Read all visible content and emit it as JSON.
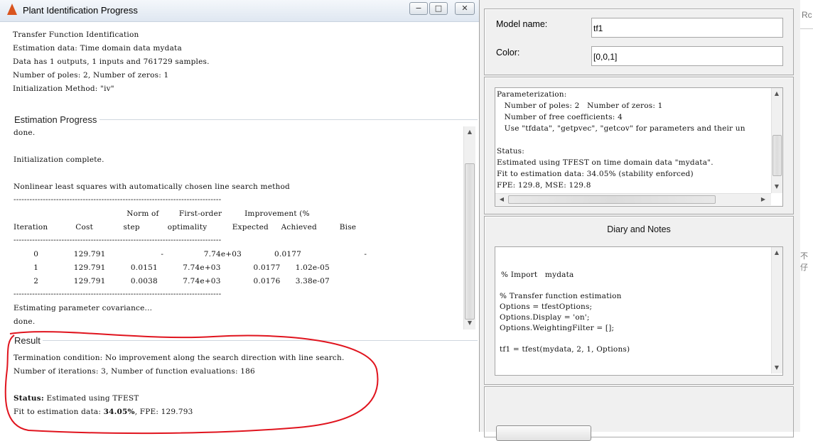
{
  "window": {
    "title": "Plant Identification Progress",
    "minimize": "−",
    "maximize": "□",
    "close": "✕"
  },
  "header_lines": [
    "Transfer Function Identification",
    "Estimation data: Time domain data mydata",
    "Data has 1 outputs, 1 inputs and 761729 samples.",
    "Number of poles: 2, Number of zeros: 1",
    "Initialization Method: \"iv\""
  ],
  "progress": {
    "title": "Estimation Progress",
    "lines": [
      "done.",
      "",
      "Initialization complete.",
      "",
      "Nonlinear least squares with automatically chosen line search method",
      "------------------------------------------------------------------------------",
      "                                             Norm of        First-order         Improvement (%",
      "Iteration           Cost            step           optimality          Expected     Achieved         Bise",
      "------------------------------------------------------------------------------",
      "",
      "        0              129.791                      -                7.74e+03             0.0177                         -",
      "        1              129.791          0.0151          7.74e+03             0.0177      1.02e-05",
      "        2              129.791          0.0038          7.74e+03             0.0176      3.38e-07",
      "------------------------------------------------------------------------------",
      "",
      "Estimating parameter covariance...",
      "done."
    ]
  },
  "result": {
    "title": "Result",
    "termination": "Termination condition: No improvement along the search direction with line search.",
    "iterations": "Number of iterations: 3, Number of function evaluations: 186",
    "status_label": "Status:",
    "status_value": " Estimated using TFEST",
    "fit_prefix": "Fit to estimation data: ",
    "fit_value": "34.05%",
    "fit_suffix": ", FPE: 129.793"
  },
  "model_panel": {
    "model_name_label": "Model name:",
    "model_name_value": "tf1",
    "color_label": "Color:",
    "color_value": "[0,0,1]"
  },
  "info": {
    "lines": [
      "Parameterization:",
      "   Number of poles: 2   Number of zeros: 1",
      "   Number of free coefficients: 4",
      "   Use \"tfdata\", \"getpvec\", \"getcov\" for parameters and their un",
      "",
      "Status:",
      "Estimated using TFEST on time domain data \"mydata\".",
      "Fit to estimation data: 34.05% (stability enforced)",
      "FPE: 129.8, MSE: 129.8"
    ]
  },
  "diary": {
    "title": "Diary and Notes",
    "lines": [
      "",
      "",
      "% Import   mydata",
      "",
      "% Transfer function estimation",
      "Options = tfestOptions;",
      "Options.Display = 'on';",
      "Options.WeightingFilter = [];",
      "",
      "tf1 = tfest(mydata, 2, 1, Options)"
    ]
  },
  "background_fragments": {
    "top_right": "Rc",
    "side_char": "不仔"
  },
  "colors": {
    "annotation_red": "#e0141e",
    "panel_bg": "#f0f0f0"
  }
}
